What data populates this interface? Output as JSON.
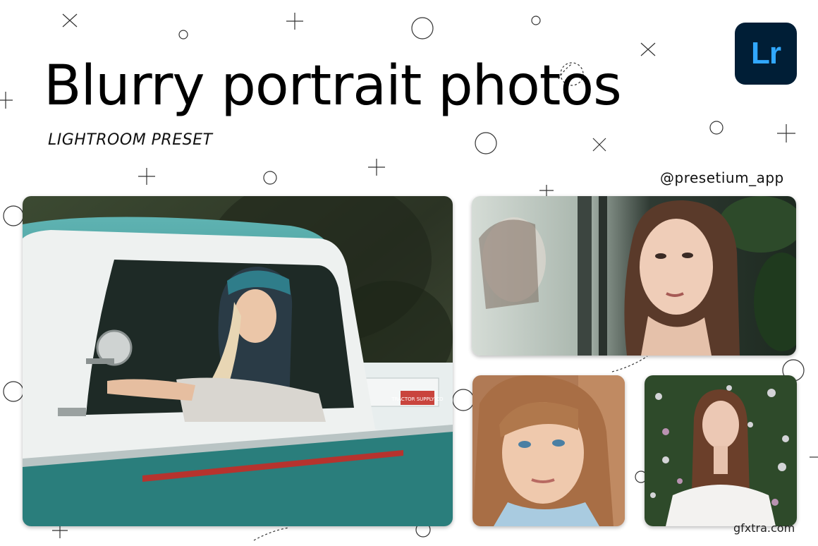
{
  "header": {
    "title": "Blurry portrait photos",
    "subtitle": "LIGHTROOM PRESET",
    "handle": "@presetium_app"
  },
  "logo": {
    "text": "Lr",
    "background_color": "#001e36",
    "text_color": "#31a8ff"
  },
  "photos": [
    {
      "id": "truck-photo"
    },
    {
      "id": "window-portrait-photo"
    },
    {
      "id": "girl-closeup-photo"
    },
    {
      "id": "woman-flowers-photo"
    }
  ],
  "truck_sign": "TRACTOR SUPPLY CO",
  "watermark": "gfxtra.com"
}
